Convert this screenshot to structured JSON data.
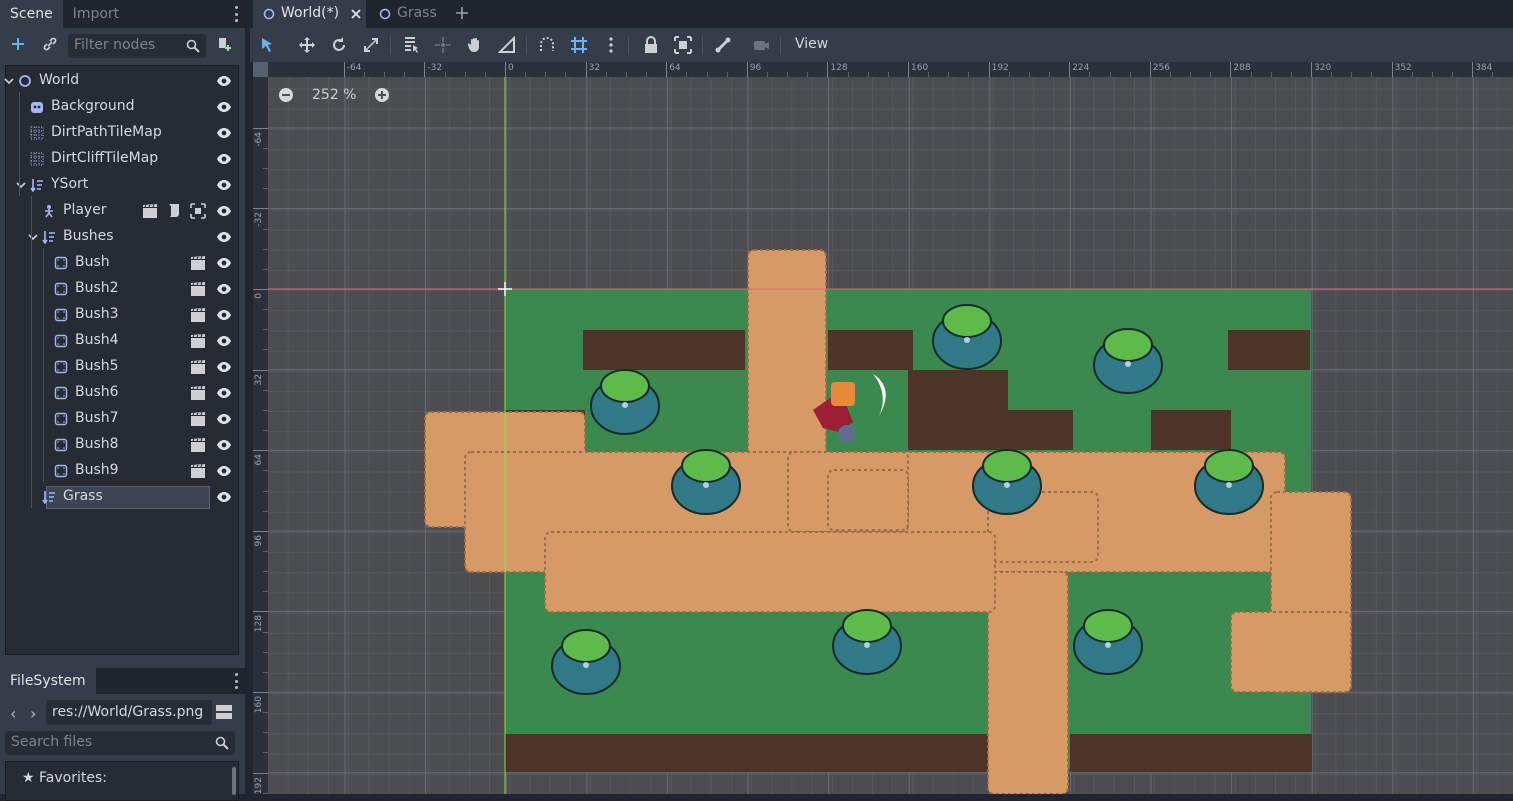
{
  "left_dock": {
    "tabs": [
      {
        "label": "Scene",
        "active": true
      },
      {
        "label": "Import",
        "active": false
      }
    ],
    "filter_placeholder": "Filter nodes",
    "tree": [
      {
        "label": "World",
        "icon": "node2d-circle-icon",
        "depth": 0,
        "expanded": true,
        "visible": true
      },
      {
        "label": "Background",
        "icon": "sprite-icon",
        "depth": 1,
        "visible": true
      },
      {
        "label": "DirtPathTileMap",
        "icon": "tilemap-icon",
        "depth": 1,
        "visible": true
      },
      {
        "label": "DirtCliffTileMap",
        "icon": "tilemap-icon",
        "depth": 1,
        "visible": true
      },
      {
        "label": "YSort",
        "icon": "ysort-icon",
        "depth": 1,
        "expanded": true,
        "visible": true
      },
      {
        "label": "Player",
        "icon": "kinematic-body-icon",
        "depth": 2,
        "visible": true,
        "extras": [
          "scene-instance-icon",
          "script-icon",
          "group-icon"
        ]
      },
      {
        "label": "Bushes",
        "icon": "ysort-icon",
        "depth": 2,
        "expanded": true,
        "visible": true
      },
      {
        "label": "Bush",
        "icon": "static-body-icon",
        "depth": 3,
        "visible": true,
        "extras": [
          "scene-instance-icon"
        ]
      },
      {
        "label": "Bush2",
        "icon": "static-body-icon",
        "depth": 3,
        "visible": true,
        "extras": [
          "scene-instance-icon"
        ]
      },
      {
        "label": "Bush3",
        "icon": "static-body-icon",
        "depth": 3,
        "visible": true,
        "extras": [
          "scene-instance-icon"
        ]
      },
      {
        "label": "Bush4",
        "icon": "static-body-icon",
        "depth": 3,
        "visible": true,
        "extras": [
          "scene-instance-icon"
        ]
      },
      {
        "label": "Bush5",
        "icon": "static-body-icon",
        "depth": 3,
        "visible": true,
        "extras": [
          "scene-instance-icon"
        ]
      },
      {
        "label": "Bush6",
        "icon": "static-body-icon",
        "depth": 3,
        "visible": true,
        "extras": [
          "scene-instance-icon"
        ]
      },
      {
        "label": "Bush7",
        "icon": "static-body-icon",
        "depth": 3,
        "visible": true,
        "extras": [
          "scene-instance-icon"
        ]
      },
      {
        "label": "Bush8",
        "icon": "static-body-icon",
        "depth": 3,
        "visible": true,
        "extras": [
          "scene-instance-icon"
        ]
      },
      {
        "label": "Bush9",
        "icon": "static-body-icon",
        "depth": 3,
        "visible": true,
        "extras": [
          "scene-instance-icon"
        ]
      },
      {
        "label": "Grass",
        "icon": "ysort-icon",
        "depth": 2,
        "visible": true,
        "selected": true
      }
    ]
  },
  "filesystem": {
    "tab": "FileSystem",
    "path": "res://World/Grass.png",
    "search_placeholder": "Search files",
    "favorites_label": "Favorites:"
  },
  "scene_tabs": [
    {
      "label": "World(*)",
      "active": true
    },
    {
      "label": "Grass",
      "active": false
    }
  ],
  "toolbar": {
    "view_menu": "View"
  },
  "viewport": {
    "zoom": "252 %",
    "ruler_top": [
      "-64",
      "-32",
      "0",
      "32",
      "64",
      "96",
      "128",
      "160",
      "192",
      "224",
      "256",
      "288",
      "320",
      "352",
      "384"
    ],
    "ruler_left": [
      "-64",
      "-32",
      "0",
      "32",
      "64",
      "96",
      "128",
      "160",
      "192"
    ]
  },
  "colors": {
    "accent": "#699ce8",
    "grass": "#3a8a50",
    "dirt": "#d59a66",
    "cliff": "#4c3426",
    "bush": "#2f7a86"
  }
}
